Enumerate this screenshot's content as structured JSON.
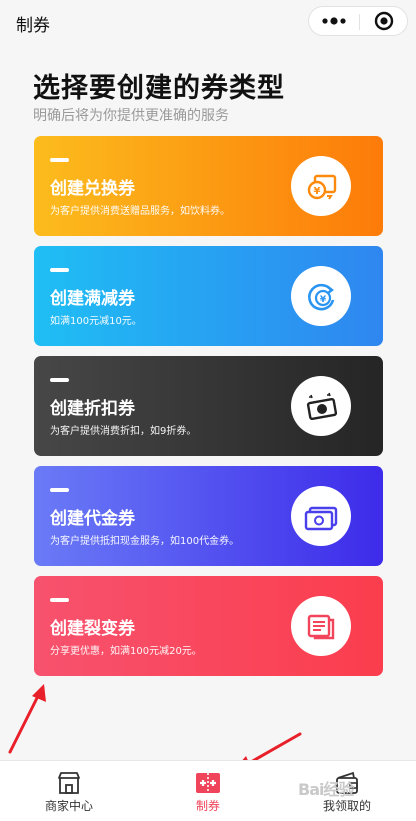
{
  "header": {
    "title": "制券",
    "more_icon": "more-dots-icon",
    "close_icon": "circle-close-icon"
  },
  "main": {
    "title": "选择要创建的券类型",
    "subtitle": "明确后将为你提供更准确的服务"
  },
  "cards": [
    {
      "title": "创建兑换券",
      "desc": "为客户提供消费送赠品服务，如饮料券。",
      "icon": "exchange-coin-icon",
      "color_from": "#fcbc1d",
      "color_to": "#fd7b09"
    },
    {
      "title": "创建满减券",
      "desc": "如满100元减10元。",
      "icon": "yen-refund-icon",
      "color_from": "#1fbef4",
      "color_to": "#2f86f0"
    },
    {
      "title": "创建折扣券",
      "desc": "为客户提供消费折扣，如9折券。",
      "icon": "discount-note-icon",
      "color_from": "#474747",
      "color_to": "#252525"
    },
    {
      "title": "创建代金券",
      "desc": "为客户提供抵扣现金服务，如100代金券。",
      "icon": "cash-voucher-icon",
      "color_from": "#6a7bf6",
      "color_to": "#3d2bea"
    },
    {
      "title": "创建裂变券",
      "desc": "分享更优惠，如满100元减20元。",
      "icon": "cash-stack-icon",
      "color_from": "#f7526e",
      "color_to": "#fb3d4d"
    }
  ],
  "tabs": [
    {
      "label": "商家中心",
      "icon": "shop-icon",
      "active": false
    },
    {
      "label": "制券",
      "icon": "create-coupon-icon",
      "active": true
    },
    {
      "label": "我领取的",
      "icon": "wallet-icon",
      "active": false
    }
  ],
  "watermark": "Bai经验",
  "colors": {
    "accent": "#f0445a",
    "arrow": "#e8202a"
  }
}
